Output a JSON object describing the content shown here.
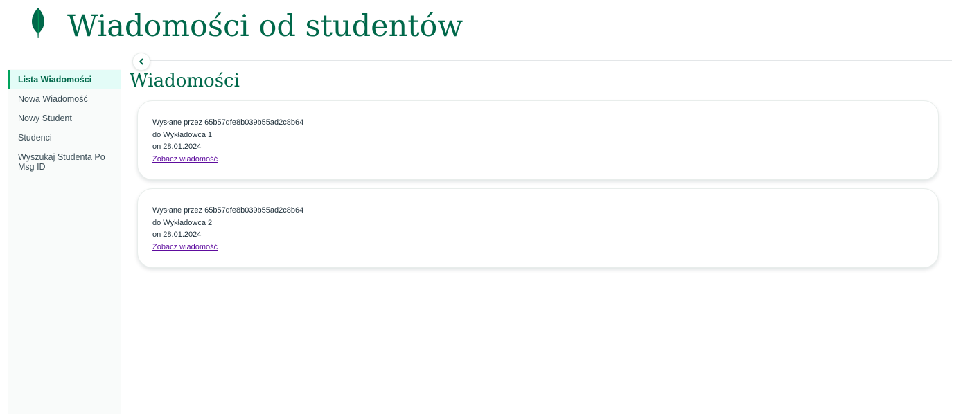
{
  "header": {
    "title": "Wiadomości od studentów",
    "logo_icon": "leaf-icon",
    "brand_color": "#00684a"
  },
  "nav": {
    "collapse_icon": "chevron-left-icon",
    "items": [
      {
        "label": "Lista Wiadomości",
        "active": true
      },
      {
        "label": "Nowa Wiadomość",
        "active": false
      },
      {
        "label": "Nowy Student",
        "active": false
      },
      {
        "label": "Studenci",
        "active": false
      },
      {
        "label": "Wyszukaj Studenta Po Msg ID",
        "active": false
      }
    ]
  },
  "main": {
    "title": "Wiadomości",
    "messages": [
      {
        "sender": "Wysłane przez 65b57dfe8b039b55ad2c8b64",
        "recipient": "do Wykładowca 1",
        "date": "on 28.01.2024",
        "link": "Zobacz wiadomość"
      },
      {
        "sender": "Wysłane przez 65b57dfe8b039b55ad2c8b64",
        "recipient": "do Wykładowca 2",
        "date": "on 28.01.2024",
        "link": "Zobacz wiadomość"
      }
    ]
  },
  "colors": {
    "accent": "#00a35c",
    "active_bg": "#e3fcf7",
    "link": "#5e0c9e"
  }
}
